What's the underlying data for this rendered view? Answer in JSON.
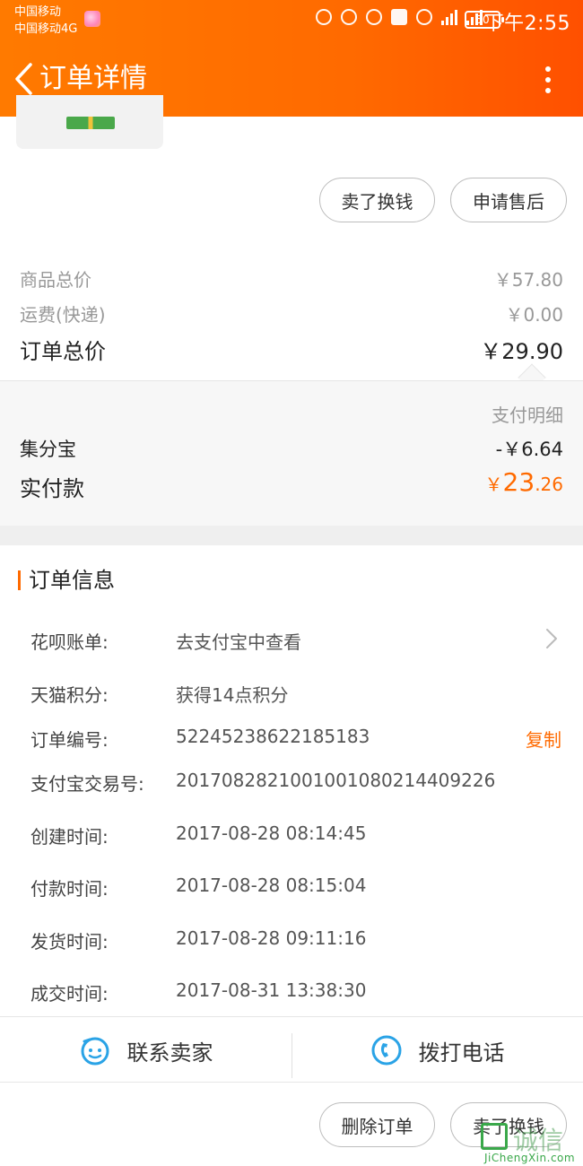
{
  "status_bar": {
    "carrier_line1": "中国移动",
    "carrier_line2": "中国移动4G",
    "battery": "50",
    "time": "下午2:55"
  },
  "header": {
    "title": "订单详情"
  },
  "actions_top": {
    "sell_label": "卖了换钱",
    "after_sale_label": "申请售后"
  },
  "prices": {
    "goods_total_label": "商品总价",
    "goods_total_value": "￥57.80",
    "shipping_label": "运费(快递)",
    "shipping_value": "￥0.00",
    "order_total_label": "订单总价",
    "order_total_value": "￥29.90"
  },
  "payment": {
    "detail_label": "支付明细",
    "jifenbao_label": "集分宝",
    "jifenbao_value": "-￥6.64",
    "paid_label": "实付款",
    "paid_currency": "￥",
    "paid_int": "23",
    "paid_dec": ".26"
  },
  "order_info": {
    "title": "订单信息",
    "rows": [
      {
        "label": "花呗账单:",
        "value": "去支付宝中查看"
      },
      {
        "label": "天猫积分:",
        "value": "获得14点积分"
      },
      {
        "label": "订单编号:",
        "value": "52245238622185183",
        "action": "复制"
      },
      {
        "label": "支付宝交易号:",
        "value": "2017082821001001080214409226"
      },
      {
        "label": "创建时间:",
        "value": "2017-08-28 08:14:45"
      },
      {
        "label": "付款时间:",
        "value": "2017-08-28 08:15:04"
      },
      {
        "label": "发货时间:",
        "value": "2017-08-28 09:11:16"
      },
      {
        "label": "成交时间:",
        "value": "2017-08-31 13:38:30"
      }
    ]
  },
  "contact": {
    "seller_label": "联系卖家",
    "call_label": "拨打电话"
  },
  "actions_bottom": {
    "delete_label": "删除订单",
    "sell_label": "卖了换钱"
  },
  "watermark": {
    "text": "诚信",
    "sub": "JiChengXin.com"
  },
  "colors": {
    "accent": "#ff6a00",
    "contact_icon": "#2aa3e6"
  }
}
